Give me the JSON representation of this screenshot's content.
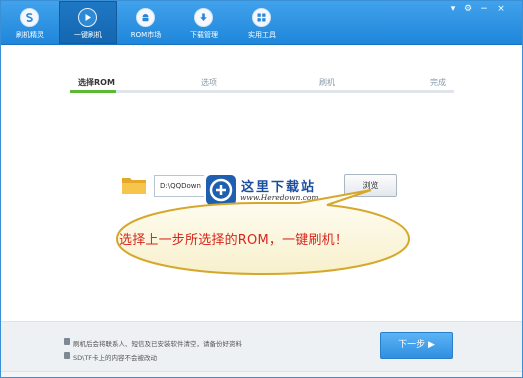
{
  "nav": {
    "items": [
      {
        "label": "刷机精灵",
        "icon": "s-logo-icon",
        "active": false
      },
      {
        "label": "一键刷机",
        "icon": "play-icon",
        "active": true
      },
      {
        "label": "ROM市场",
        "icon": "android-icon",
        "active": false
      },
      {
        "label": "下载管理",
        "icon": "download-icon",
        "active": false
      },
      {
        "label": "实用工具",
        "icon": "grid-icon",
        "active": false
      }
    ],
    "window_controls": [
      "menu-icon",
      "settings-icon",
      "minimize-icon",
      "close-icon"
    ]
  },
  "steps": {
    "items": [
      "选择ROM",
      "选项",
      "刷机",
      "完成"
    ],
    "current_index": 0,
    "progress": 0.12
  },
  "rom": {
    "path_value": "D:\\QQDown",
    "browse_label": "浏览"
  },
  "watermark": {
    "title": "这里下载站",
    "url": "www.Heredown.com"
  },
  "callout": {
    "text": "选择上一步所选择的ROM，一键刷机！"
  },
  "footer": {
    "notes": [
      "刷机后会将联系人、短信及已安装软件清空，请备份好资料",
      "SD\\TF卡上的内容不会被改动"
    ],
    "next_label": "下一步 ▶"
  },
  "colors": {
    "topbar": "#2b91e2",
    "progress": "#5cb837",
    "callout_text": "#d8261c",
    "next_button": "#3b9ae8"
  }
}
